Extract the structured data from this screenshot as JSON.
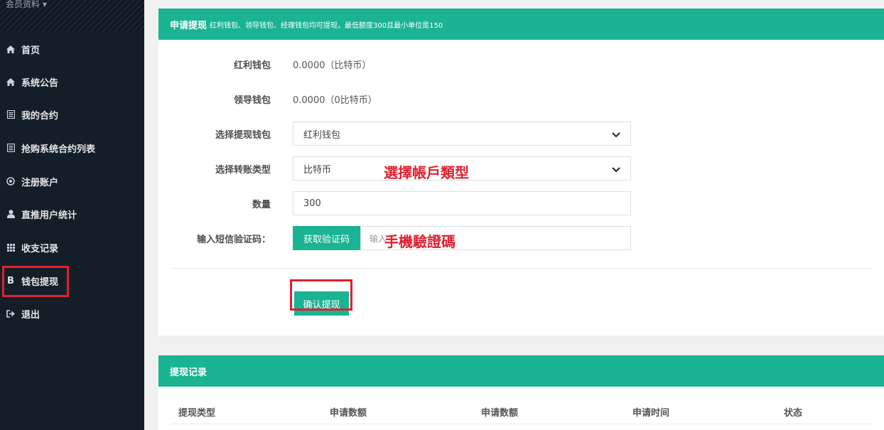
{
  "sidebar": {
    "member_label": "会员资料",
    "items": [
      {
        "label": "首页",
        "icon": "home-icon"
      },
      {
        "label": "系统公告",
        "icon": "home-icon"
      },
      {
        "label": "我的合约",
        "icon": "list-icon"
      },
      {
        "label": "抢购系统合约列表",
        "icon": "list-icon"
      },
      {
        "label": "注册账户",
        "icon": "registered-icon"
      },
      {
        "label": "直推用户统计",
        "icon": "user-icon"
      },
      {
        "label": "收支记录",
        "icon": "grid-icon"
      },
      {
        "label": "钱包提现",
        "icon": "bitcoin-icon"
      },
      {
        "label": "退出",
        "icon": "sign-out-icon"
      }
    ],
    "active_index": 7
  },
  "withdraw": {
    "title": "申请提现",
    "subtitle": "红利钱包、领导钱包、经理钱包均可提现，最低额度300且最小单位是150",
    "bonus_wallet_label": "红利钱包",
    "bonus_wallet_value": "0.0000（比特币）",
    "leader_wallet_label": "领导钱包",
    "leader_wallet_value": "0.0000（0比特币）",
    "select_wallet_label": "选择提现钱包",
    "select_wallet_value": "红利钱包",
    "transfer_type_label": "选择转账类型",
    "transfer_type_value": "比特币",
    "amount_label": "数量",
    "amount_value": "300",
    "sms_label": "输入短信验证码：",
    "sms_button": "获取验证码",
    "sms_placeholder": "输入",
    "confirm_button": "确认提现"
  },
  "annotations": {
    "account_type": "選擇帳戶類型",
    "phone_code": "手機驗證碼"
  },
  "records": {
    "title": "提现记录",
    "columns": [
      "提现类型",
      "申请数额",
      "申请数额",
      "申请时间",
      "状态"
    ]
  },
  "colors": {
    "accent": "#1ab394",
    "sidebar_bg": "#141e29",
    "highlight": "#e0202b",
    "annotation": "#e02030"
  }
}
